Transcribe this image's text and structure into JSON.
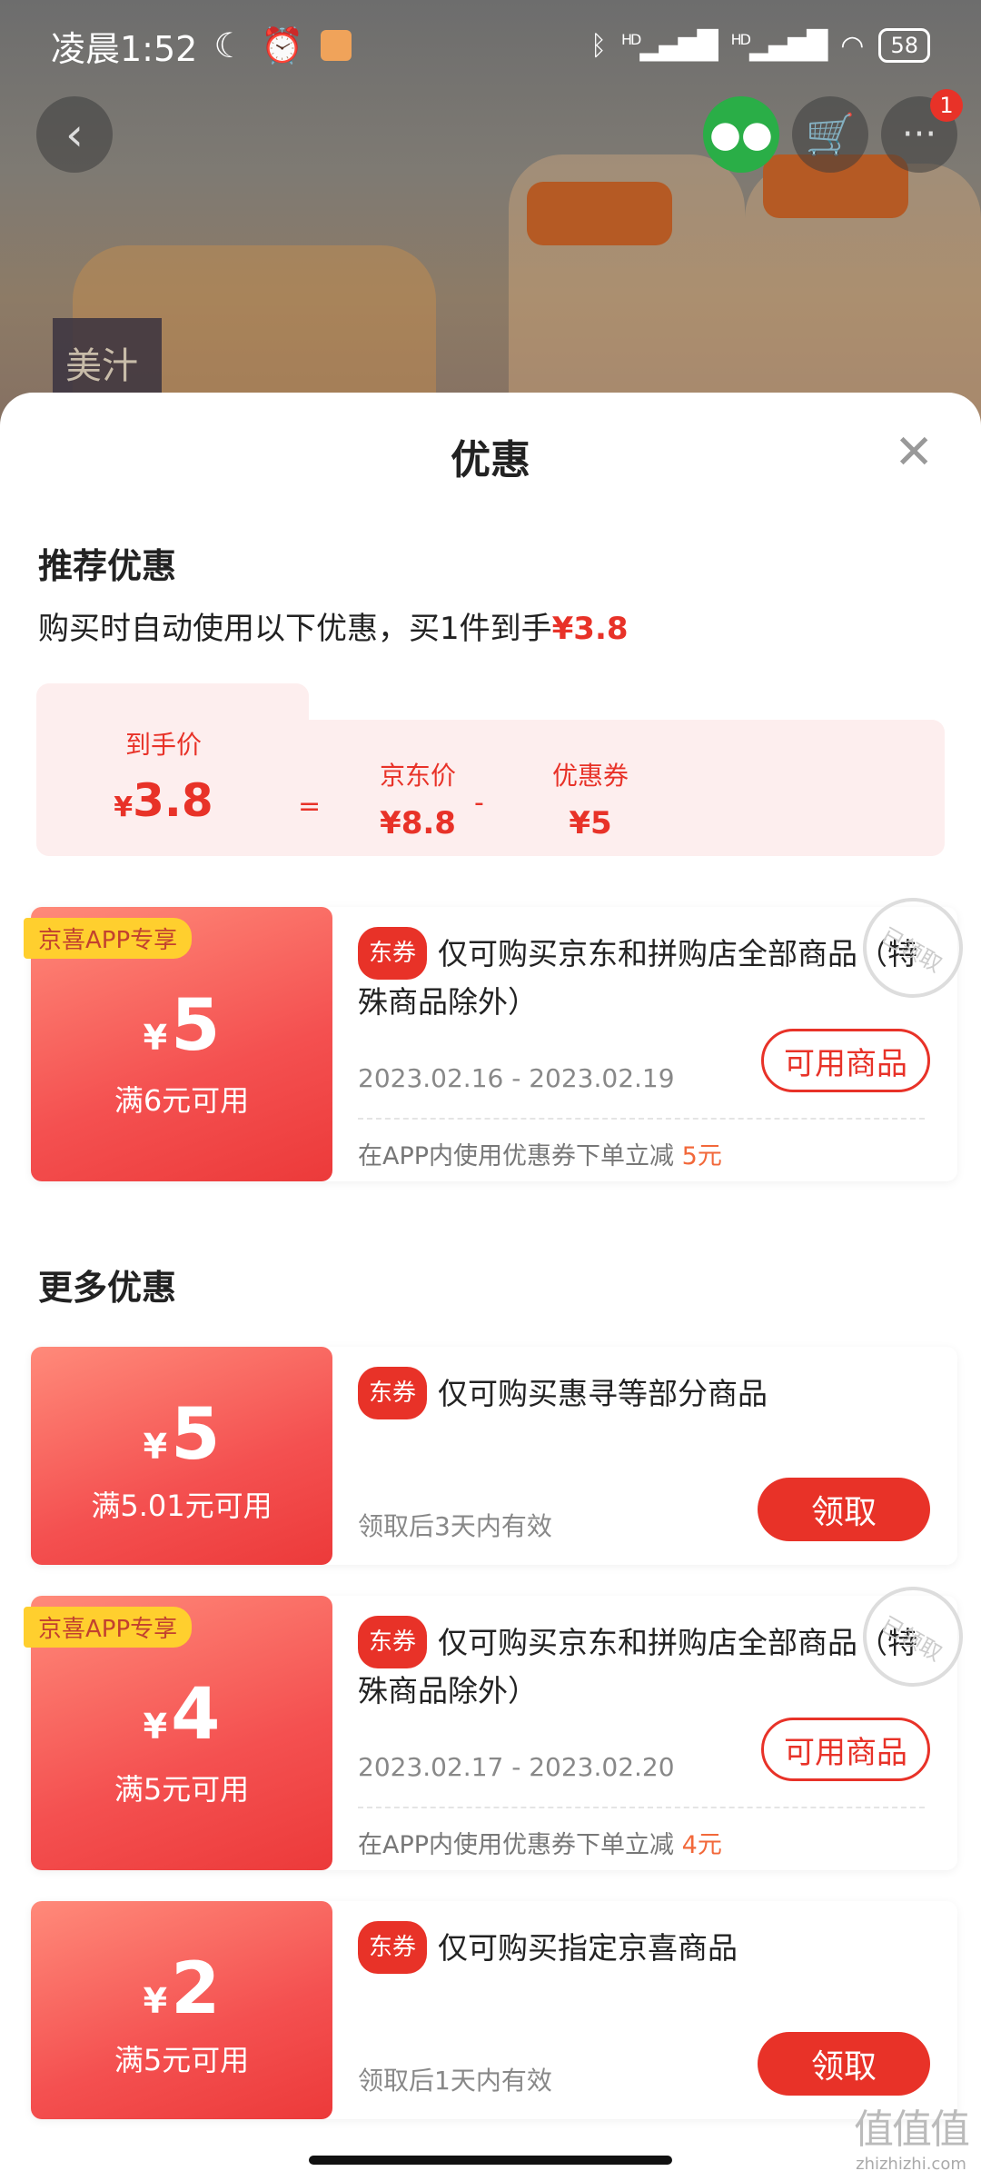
{
  "status_bar": {
    "time": "凌晨1:52",
    "moon_icon": "moon-icon",
    "alarm_icon": "alarm-icon",
    "hd1": "HD",
    "hd2": "HD",
    "battery": "58"
  },
  "header": {
    "back_icon": "back-arrow-icon",
    "wechat_icon": "wechat-icon",
    "cart_icon": "cart-icon",
    "more_icon": "more-icon",
    "more_badge": "1",
    "product_brand": "美汁源"
  },
  "sheet": {
    "title": "优惠",
    "close_icon": "close-icon",
    "recommend_title": "推荐优惠",
    "recommend_desc_prefix": "购买时自动使用以下优惠，买1件到手",
    "recommend_desc_price": "¥3.8",
    "calc": {
      "final_label": "到手价",
      "final_yen": "¥",
      "final_value": "3.8",
      "eq": "=",
      "jd_label": "京东价",
      "jd_value": "¥8.8",
      "minus": "-",
      "coupon_label": "优惠券",
      "coupon_value": "¥5"
    },
    "more_title": "更多优惠"
  },
  "coupons": [
    {
      "exclusive": "京喜APP专享",
      "yen": "¥",
      "amount": "5",
      "cond": "满6元可用",
      "tag": "东券",
      "desc": "仅可购买京东和拼购店全部商品（特殊商品除外）",
      "date": "2023.02.16 - 2023.02.19",
      "button": "可用商品",
      "note_prefix": "在APP内使用优惠券下单立减",
      "note_amount": "5元",
      "stamp": "已领取"
    },
    {
      "yen": "¥",
      "amount": "5",
      "cond": "满5.01元可用",
      "tag": "东券",
      "desc": "仅可购买惠寻等部分商品",
      "date": "领取后3天内有效",
      "button": "领取"
    },
    {
      "exclusive": "京喜APP专享",
      "yen": "¥",
      "amount": "4",
      "cond": "满5元可用",
      "tag": "东券",
      "desc": "仅可购买京东和拼购店全部商品（特殊商品除外）",
      "date": "2023.02.17 - 2023.02.20",
      "button": "可用商品",
      "note_prefix": "在APP内使用优惠券下单立减",
      "note_amount": "4元",
      "stamp": "已领取"
    },
    {
      "yen": "¥",
      "amount": "2",
      "cond": "满5元可用",
      "tag": "东券",
      "desc": "仅可购买指定京喜商品",
      "date": "领取后1天内有效",
      "button": "领取"
    }
  ],
  "watermark": {
    "big": "值值值",
    "small": "zhizhizhi.com"
  },
  "colors": {
    "accent_red": "#e83228",
    "exclusive_yellow": "#ffcf2e",
    "wechat_green": "#2aae47"
  }
}
